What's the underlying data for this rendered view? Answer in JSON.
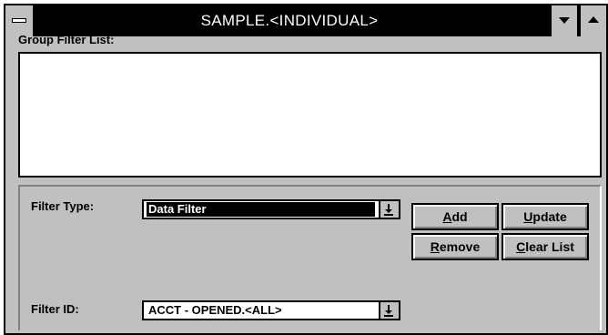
{
  "window": {
    "title": "SAMPLE.<INDIVIDUAL>"
  },
  "group_filter": {
    "label": "Group Filter List:",
    "items": []
  },
  "filter_type": {
    "label": "Filter Type:",
    "value": "Data Filter"
  },
  "filter_id": {
    "label": "Filter ID:",
    "value": "ACCT - OPENED.<ALL>"
  },
  "buttons": {
    "add": {
      "accel": "A",
      "rest": "dd"
    },
    "update": {
      "accel": "U",
      "rest": "pdate"
    },
    "remove": {
      "accel": "R",
      "rest": "emove"
    },
    "clear_list": {
      "accel": "C",
      "rest": "lear List"
    }
  },
  "icons": {
    "system_menu": "system-menu-icon",
    "minimize": "minimize-arrow-icon",
    "maximize": "maximize-arrow-icon",
    "dropdown": "dropdown-arrow-icon"
  },
  "colors": {
    "face": "#c0c0c0",
    "titlebar": "#000000",
    "selection": "#000000"
  }
}
